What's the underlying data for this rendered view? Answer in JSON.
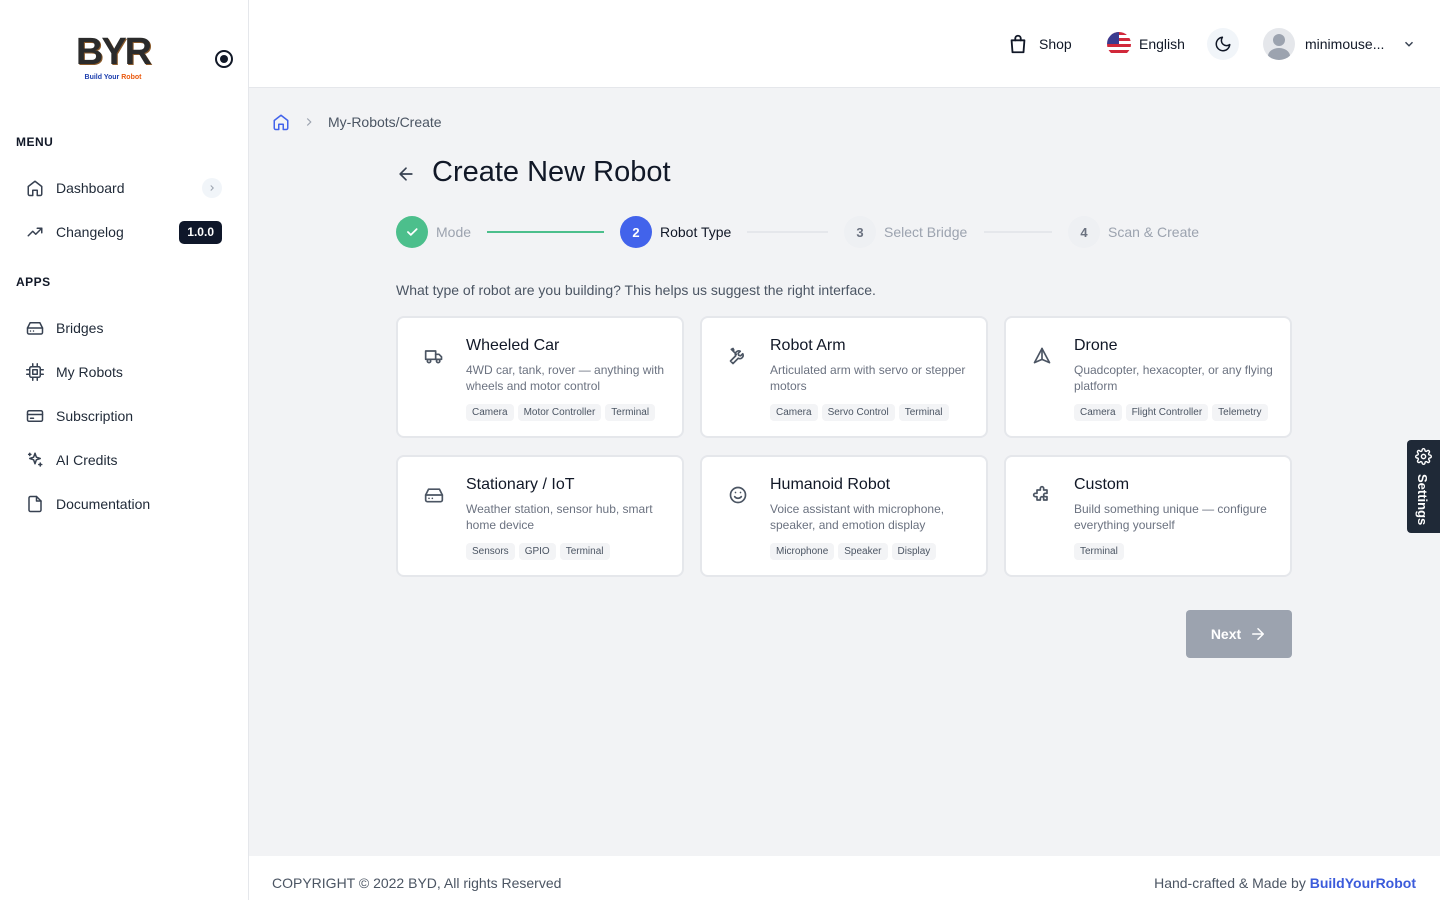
{
  "sidebar": {
    "logo_text": "BYR",
    "logo_tagline_prefix": "Build Your",
    "logo_tagline_accent": "Robot",
    "menu_label": "MENU",
    "apps_label": "APPS",
    "menu_items": [
      {
        "label": "Dashboard",
        "icon": "home-icon"
      },
      {
        "label": "Changelog",
        "icon": "trending-up-icon",
        "badge": "1.0.0"
      }
    ],
    "app_items": [
      {
        "label": "Bridges",
        "icon": "hard-drive-icon"
      },
      {
        "label": "My Robots",
        "icon": "cpu-icon"
      },
      {
        "label": "Subscription",
        "icon": "credit-card-icon"
      },
      {
        "label": "AI Credits",
        "icon": "sparkles-icon"
      },
      {
        "label": "Documentation",
        "icon": "file-icon"
      }
    ]
  },
  "header": {
    "shop_label": "Shop",
    "language_label": "English",
    "username": "minimouse..."
  },
  "breadcrumb": {
    "path": "My-Robots/Create"
  },
  "page": {
    "title": "Create New Robot",
    "intro": "What type of robot are you building? This helps us suggest the right interface."
  },
  "stepper": {
    "steps": [
      {
        "number": "",
        "label": "Mode",
        "state": "done"
      },
      {
        "number": "2",
        "label": "Robot Type",
        "state": "active"
      },
      {
        "number": "3",
        "label": "Select Bridge",
        "state": "pending"
      },
      {
        "number": "4",
        "label": "Scan & Create",
        "state": "pending"
      }
    ]
  },
  "robot_types": [
    {
      "title": "Wheeled Car",
      "description": "4WD car, tank, rover — anything with wheels and motor control",
      "tags": [
        "Camera",
        "Motor Controller",
        "Terminal"
      ],
      "icon": "truck-icon"
    },
    {
      "title": "Robot Arm",
      "description": "Articulated arm with servo or stepper motors",
      "tags": [
        "Camera",
        "Servo Control",
        "Terminal"
      ],
      "icon": "tools-icon"
    },
    {
      "title": "Drone",
      "description": "Quadcopter, hexacopter, or any flying platform",
      "tags": [
        "Camera",
        "Flight Controller",
        "Telemetry"
      ],
      "icon": "navigation-icon"
    },
    {
      "title": "Stationary / IoT",
      "description": "Weather station, sensor hub, smart home device",
      "tags": [
        "Sensors",
        "GPIO",
        "Terminal"
      ],
      "icon": "server-icon"
    },
    {
      "title": "Humanoid Robot",
      "description": "Voice assistant with microphone, speaker, and emotion display",
      "tags": [
        "Microphone",
        "Speaker",
        "Display"
      ],
      "icon": "smile-icon"
    },
    {
      "title": "Custom",
      "description": "Build something unique — configure everything yourself",
      "tags": [
        "Terminal"
      ],
      "icon": "puzzle-icon"
    }
  ],
  "actions": {
    "next_label": "Next"
  },
  "settings_tab": {
    "label": "Settings"
  },
  "footer": {
    "copyright": "COPYRIGHT © 2022 BYD, All rights Reserved",
    "credit_prefix": "Hand-crafted & Made by",
    "credit_brand": "BuildYourRobot"
  },
  "colors": {
    "accent": "#4263eb",
    "success": "#4cbf8c",
    "disabled_button": "#9ca3af",
    "brand_link": "#3b5bdb"
  }
}
